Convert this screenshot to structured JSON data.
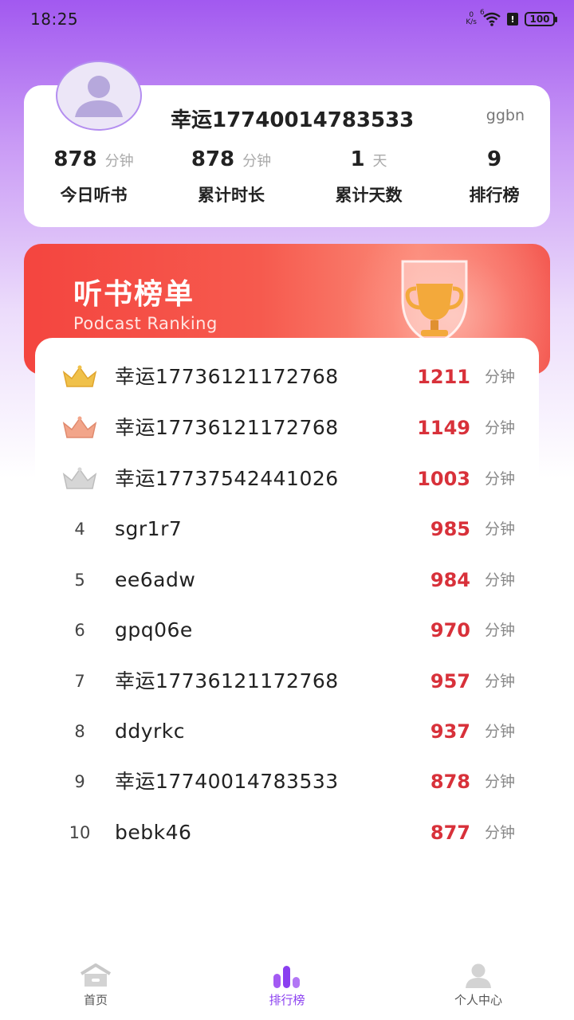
{
  "status_bar": {
    "time": "18:25",
    "net_speed_value": "0",
    "net_speed_unit": "K/s",
    "wifi_badge": "6",
    "sim_label": "!",
    "battery": "100"
  },
  "profile": {
    "username": "幸运17740014783533",
    "tag": "ggbn",
    "avatar_icon": "user-silhouette-icon",
    "stats": [
      {
        "value": "878",
        "unit": "分钟",
        "label": "今日听书"
      },
      {
        "value": "878",
        "unit": "分钟",
        "label": "累计时长"
      },
      {
        "value": "1",
        "unit": "天",
        "label": "累计天数"
      },
      {
        "value": "9",
        "unit": "",
        "label": "排行榜"
      }
    ]
  },
  "banner": {
    "title": "听书榜单",
    "subtitle": "Podcast Ranking",
    "icon": "trophy-icon"
  },
  "ranking": {
    "unit": "分钟",
    "value_color": "#d8313a",
    "rows": [
      {
        "rank": "1",
        "crown": "gold",
        "name": "幸运17736121172768",
        "value": "1211"
      },
      {
        "rank": "2",
        "crown": "bronze",
        "name": "幸运17736121172768",
        "value": "1149"
      },
      {
        "rank": "3",
        "crown": "silver",
        "name": "幸运17737542441026",
        "value": "1003"
      },
      {
        "rank": "4",
        "name": "sgr1r7",
        "value": "985"
      },
      {
        "rank": "5",
        "name": "ee6adw",
        "value": "984"
      },
      {
        "rank": "6",
        "name": "gpq06e",
        "value": "970"
      },
      {
        "rank": "7",
        "name": "幸运17736121172768",
        "value": "957"
      },
      {
        "rank": "8",
        "name": "ddyrkc",
        "value": "937"
      },
      {
        "rank": "9",
        "name": "幸运17740014783533",
        "value": "878"
      },
      {
        "rank": "10",
        "name": "bebk46",
        "value": "877"
      }
    ]
  },
  "bottom_nav": {
    "accent": "#8a3ff0",
    "items": [
      {
        "label": "首页",
        "icon": "home-icon",
        "active": false
      },
      {
        "label": "排行榜",
        "icon": "bar-chart-icon",
        "active": true
      },
      {
        "label": "个人中心",
        "icon": "person-icon",
        "active": false
      }
    ]
  }
}
